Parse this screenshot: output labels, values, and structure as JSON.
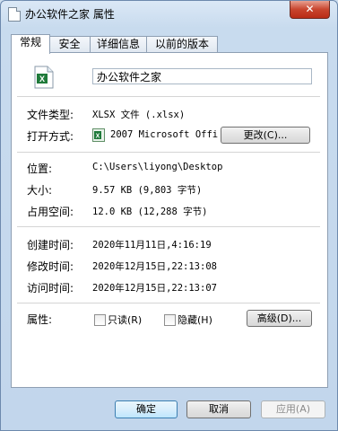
{
  "window": {
    "title": "办公软件之家 属性",
    "close_glyph": "✕"
  },
  "tabs": [
    "常规",
    "安全",
    "详细信息",
    "以前的版本"
  ],
  "general": {
    "file_name": "办公软件之家",
    "file_type_label": "文件类型:",
    "file_type_value": "XLSX 文件 (.xlsx)",
    "open_with_label": "打开方式:",
    "open_with_value": "2007 Microsoft Offi",
    "change_button": "更改(C)...",
    "location_label": "位置:",
    "location_value": "C:\\Users\\liyong\\Desktop",
    "size_label": "大小:",
    "size_value": "9.57 KB (9,803 字节)",
    "size_on_disk_label": "占用空间:",
    "size_on_disk_value": "12.0 KB (12,288 字节)",
    "created_label": "创建时间:",
    "created_value": "2020年11月11日,4:16:19",
    "modified_label": "修改时间:",
    "modified_value": "2020年12月15日,22:13:08",
    "accessed_label": "访问时间:",
    "accessed_value": "2020年12月15日,22:13:07",
    "attributes_label": "属性:",
    "readonly_label": "只读(R)",
    "hidden_label": "隐藏(H)",
    "advanced_button": "高级(D)..."
  },
  "footer": {
    "ok": "确定",
    "cancel": "取消",
    "apply": "应用(A)"
  },
  "icons": {
    "file_icon": "excel-file-icon",
    "app_icon": "excel-app-icon"
  },
  "colors": {
    "excel_green": "#1f7a3a",
    "accent_blue": "#3c7fb1"
  }
}
